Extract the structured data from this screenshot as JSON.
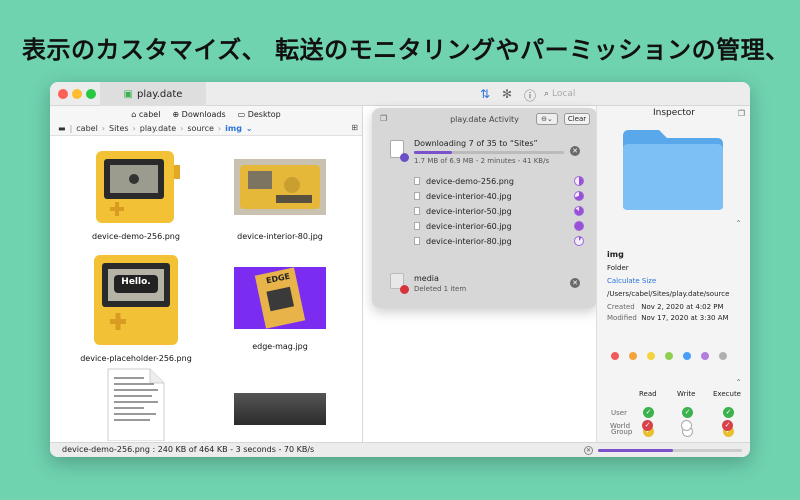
{
  "headline": "表示のカスタマイズ、 転送のモニタリングやパーミッションの管理、",
  "colors": {
    "background": "#6fd3b0",
    "accent": "#2a74d9",
    "progress": "#7b52c9"
  },
  "window": {
    "tab_title": "play.date",
    "search_placeholder": "Local"
  },
  "favorites": [
    "cabel",
    "Downloads",
    "Desktop"
  ],
  "path": [
    "cabel",
    "Sites",
    "play.date",
    "source",
    "img"
  ],
  "files": [
    {
      "name": "device-demo-256.png"
    },
    {
      "name": "device-interior-80.jpg"
    },
    {
      "name": "device-placeholder-256.png",
      "thumb_text": "Hello."
    },
    {
      "name": "edge-mag.jpg",
      "thumb_text": "EDGE"
    }
  ],
  "activity": {
    "title": "play.date Activity",
    "clear_label": "Clear",
    "transfer": {
      "title": "Downloading 7 of 35 to “Sites”",
      "subtitle": "1.7 MB of 6.9 MB - 2 minutes - 41 KB/s",
      "progress": 0.25,
      "items": [
        {
          "name": "device-demo-256.png",
          "progress": 0.5
        },
        {
          "name": "device-interior-40.jpg",
          "progress": 0.7
        },
        {
          "name": "device-interior-50.jpg",
          "progress": 0.85
        },
        {
          "name": "device-interior-60.jpg",
          "progress": 1.0
        },
        {
          "name": "device-interior-80.jpg",
          "progress": 0.1
        }
      ]
    },
    "delete": {
      "title": "media",
      "subtitle": "Deleted 1 item"
    }
  },
  "inspector": {
    "title": "Inspector",
    "name": "img",
    "kind": "Folder",
    "calc_size_label": "Calculate Size",
    "path": "/Users/cabel/Sites/play.date/source",
    "created_label": "Created",
    "created_value": "Nov 2, 2020 at 4:02 PM",
    "modified_label": "Modified",
    "modified_value": "Nov 17, 2020 at 3:30 AM",
    "tag_colors": [
      "#f05a5a",
      "#f5a33a",
      "#f5d33a",
      "#8fd14f",
      "#4a9ef5",
      "#b27ee0",
      "#b0b0b0"
    ],
    "perm_headers": [
      "Read",
      "Write",
      "Execute"
    ],
    "perm_rows": [
      {
        "label": "User",
        "values": [
          "green",
          "green",
          "green"
        ]
      },
      {
        "label": "Group",
        "values": [
          "yellow",
          "empty",
          "yellow"
        ]
      },
      {
        "label": "World",
        "values": [
          "red",
          "empty",
          "red"
        ]
      }
    ]
  },
  "status": {
    "text": "device-demo-256.png : 240 KB of 464 KB - 3 seconds - 70 KB/s",
    "progress": 0.52
  }
}
